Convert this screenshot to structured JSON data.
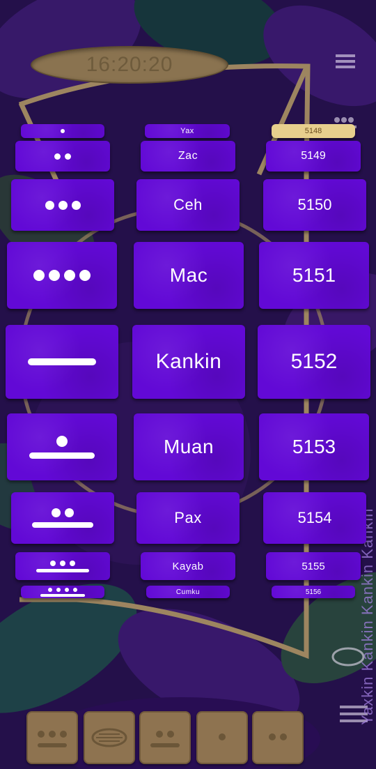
{
  "clock": {
    "time": "16:20:20"
  },
  "side_text": "Yaxkin Kankin Kankin Kankin",
  "rows": [
    {
      "dots": 1,
      "bars": 0,
      "month": "Yax",
      "year": "5148",
      "highlight_year": true
    },
    {
      "dots": 2,
      "bars": 0,
      "month": "Zac",
      "year": "5149",
      "highlight_year": false
    },
    {
      "dots": 3,
      "bars": 0,
      "month": "Ceh",
      "year": "5150",
      "highlight_year": false
    },
    {
      "dots": 4,
      "bars": 0,
      "month": "Mac",
      "year": "5151",
      "highlight_year": false
    },
    {
      "dots": 0,
      "bars": 1,
      "month": "Kankin",
      "year": "5152",
      "highlight_year": false
    },
    {
      "dots": 1,
      "bars": 1,
      "month": "Muan",
      "year": "5153",
      "highlight_year": false
    },
    {
      "dots": 2,
      "bars": 1,
      "month": "Pax",
      "year": "5154",
      "highlight_year": false
    },
    {
      "dots": 3,
      "bars": 1,
      "month": "Kayab",
      "year": "5155",
      "highlight_year": false
    },
    {
      "dots": 4,
      "bars": 1,
      "month": "Cumku",
      "year": "5156",
      "highlight_year": false
    }
  ],
  "bottom_buttons": [
    {
      "name": "three-dots-one-bar",
      "dots": 3,
      "bars": 1
    },
    {
      "name": "shell-icon",
      "dots": 0,
      "bars": 0
    },
    {
      "name": "two-dots-one-bar",
      "dots": 2,
      "bars": 1
    },
    {
      "name": "one-dot",
      "dots": 1,
      "bars": 0
    },
    {
      "name": "two-dots",
      "dots": 2,
      "bars": 0
    }
  ],
  "colors": {
    "tile": "#6209d6",
    "tile_highlight": "#e7cf8d",
    "clock_bg": "#8a7350",
    "frame": "#9d8560"
  }
}
